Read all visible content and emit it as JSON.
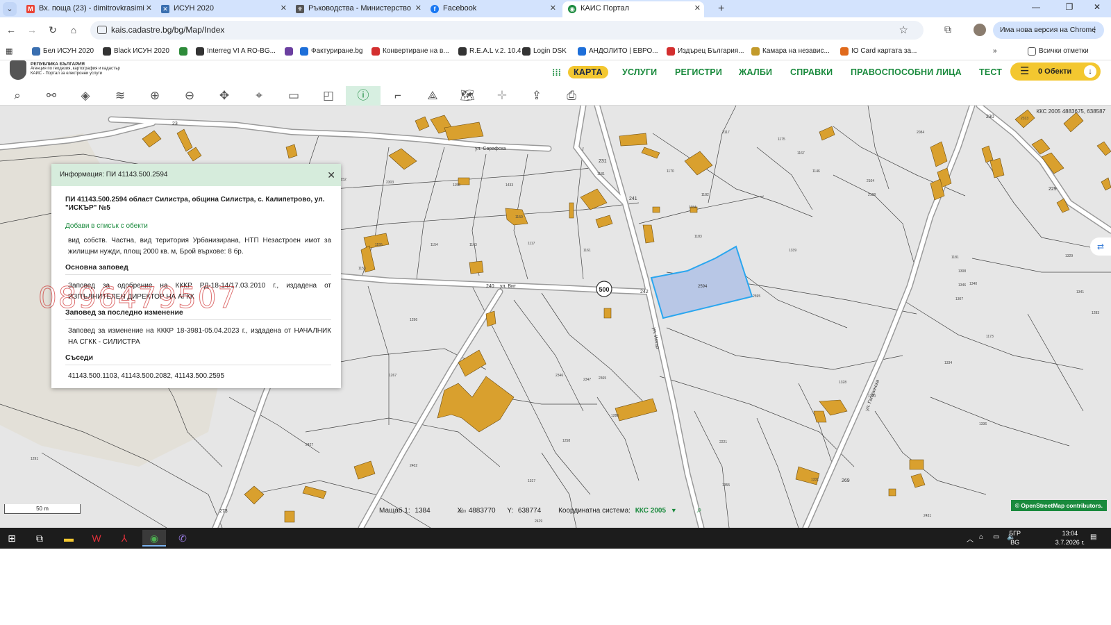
{
  "browser": {
    "tabs": [
      {
        "title": "Вх. поща (23) - dimitrovkrasimi",
        "favicon": "gmail-icon",
        "color": "#ea4335",
        "glyph": "M"
      },
      {
        "title": "ИСУН 2020",
        "favicon": "isun-icon",
        "color": "#3a6fb0",
        "glyph": "✕"
      },
      {
        "title": "Ръководства - Министерство",
        "favicon": "ministry-icon",
        "color": "#555555",
        "glyph": "⚜"
      },
      {
        "title": "Facebook",
        "favicon": "facebook-icon",
        "color": "#1877f2",
        "glyph": "f"
      },
      {
        "title": "КАИС Портал",
        "favicon": "kais-icon",
        "color": "#1a8a3d",
        "glyph": "◉"
      }
    ],
    "url": "kais.cadastre.bg/bg/Map/Index",
    "update_label": "Има нова версия на Chrome",
    "bookmarks": [
      {
        "label": "Бел ИСУН 2020",
        "color": "#3a6fb0"
      },
      {
        "label": "Black ИСУН 2020",
        "color": "#333333"
      },
      {
        "label": "",
        "color": "#2e8b3a"
      },
      {
        "label": "Interreg VI A RO-BG...",
        "color": "#333333"
      },
      {
        "label": "",
        "color": "#6b3fa0"
      },
      {
        "label": "Фактуриране.bg",
        "color": "#1e6fd9"
      },
      {
        "label": "Конвертиране на в...",
        "color": "#d32f2f"
      },
      {
        "label": "R.E.A.L v.2. 10.4",
        "color": "#333333"
      },
      {
        "label": "Login DSK",
        "color": "#333333"
      },
      {
        "label": "АНДОЛИТО | ЕВРО...",
        "color": "#1e6fd9"
      },
      {
        "label": "Издърец България...",
        "color": "#d32f2f"
      },
      {
        "label": "Камара на независ...",
        "color": "#c29a2b"
      },
      {
        "label": "IO Card картата за...",
        "color": "#e06a1c"
      }
    ],
    "all_bookmarks_label": "Всички отметки"
  },
  "site": {
    "logo_line1": "РЕПУБЛИКА БЪЛГАРИЯ",
    "logo_line2": "Агенция по геодезия, картография и кадастър",
    "logo_line3": "КАИС - Портал за електронни услуги",
    "nav": [
      "КАРТА",
      "УСЛУГИ",
      "РЕГИСТРИ",
      "ЖАЛБИ",
      "СПРАВКИ",
      "ПРАВОСПОСОБНИ ЛИЦА",
      "ТЕСТ"
    ],
    "objects_label": "0 Обекти"
  },
  "map": {
    "coords_top": "ККС 2005 4883675, 638587",
    "scale_bar": "50 m",
    "scale_label": "Мащаб 1:",
    "scale_value": "1384",
    "x_label": "X:",
    "x_value": "4883770",
    "y_label": "Y:",
    "y_value": "638774",
    "coord_sys_label": "Координатна система:",
    "coord_sys_value": "ККС 2005",
    "attribution": "© OpenStreetMap contributors.",
    "road_label": "500",
    "street_labels": [
      "ул. Сарафска",
      "ул. Вит",
      "ул. Искър",
      "ул. Гагаринска"
    ],
    "point_labels": [
      "231",
      "241",
      "240",
      "242",
      "230",
      "229",
      "269",
      "273",
      "23"
    ],
    "selected_parcel": "2594",
    "parcel_labels": [
      "2301",
      "1155",
      "1153",
      "1152",
      "1158",
      "1433",
      "2303",
      "1150",
      "1154",
      "1163",
      "1117",
      "1161",
      "1181",
      "1182",
      "1175",
      "2346",
      "1267",
      "1296",
      "2347",
      "2365",
      "2402",
      "1317",
      "1309",
      "1258",
      "1286",
      "2595",
      "1183",
      "1184",
      "1170",
      "1167",
      "1181",
      "1307",
      "1308",
      "1346",
      "1341",
      "1329",
      "1334",
      "1336",
      "2221",
      "1146",
      "1173",
      "1340",
      "1339",
      "2084",
      "2104",
      "2108",
      "2117",
      "2313",
      "1270",
      "2427",
      "2429",
      "2431",
      "1328",
      "1331",
      "1355",
      "1291",
      "1283"
    ]
  },
  "popup": {
    "header": "Информация: ПИ 41143.500.2594",
    "title": "ПИ 41143.500.2594 област Силистра, община Силистра, с. Калипетрово, ул. \"ИСКЪР\" №5",
    "add_link": "Добави в списък с обекти",
    "description": "вид собств. Частна, вид територия Урбанизирана, НТП Незастроен имот за жилищни нужди, площ 2000 кв. м, Брой върхове: 8 бр.",
    "section_main": "Основна заповед",
    "main_order": "Заповед за одобрение на КККР РД-18-14/17.03.2010 г., издадена от ИЗПЪЛНИТЕЛЕН ДИРЕКТОР НА АГКК",
    "section_last": "Заповед за последно изменение",
    "last_order": "Заповед за изменение на КККР 18-3981-05.04.2023 г., издадена от НАЧАЛНИК НА СГКК - СИЛИСТРА",
    "section_neighbors": "Съседи",
    "neighbors": "41143.500.1103, 41143.500.2082, 41143.500.2595"
  },
  "watermark": "0896479507",
  "taskbar": {
    "lang_top": "БГР",
    "lang_bottom": "BG",
    "time": "13:04",
    "date": "3.7.2026 г."
  },
  "colors": {
    "accent_green": "#1a8a3d",
    "accent_yellow": "#f3c730",
    "building": "#d9a02e",
    "selected_fill": "#b8c7e6",
    "selected_stroke": "#2aa6ef"
  }
}
